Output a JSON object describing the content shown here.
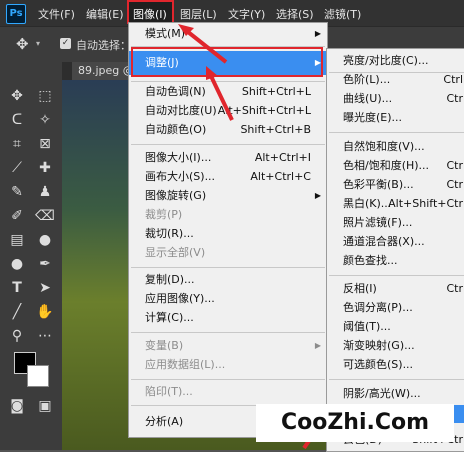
{
  "menubar": {
    "logo": "Ps",
    "items": [
      "文件(F)",
      "编辑(E)",
      "图像(I)",
      "图层(L)",
      "文字(Y)",
      "选择(S)",
      "滤镜(T)"
    ]
  },
  "options": {
    "auto_select_label": "自动选择："
  },
  "document": {
    "tab_label": "89.jpeg @"
  },
  "image_menu": [
    {
      "label": "模式(M)",
      "shortcut": "",
      "submenu": true
    },
    {
      "label": "调整(J)",
      "shortcut": "",
      "submenu": true,
      "highlighted": true
    },
    {
      "label": "自动色调(N)",
      "shortcut": "Shift+Ctrl+L"
    },
    {
      "label": "自动对比度(U)",
      "shortcut": "Alt+Shift+Ctrl+L"
    },
    {
      "label": "自动颜色(O)",
      "shortcut": "Shift+Ctrl+B"
    },
    {
      "label": "图像大小(I)...",
      "shortcut": "Alt+Ctrl+I"
    },
    {
      "label": "画布大小(S)...",
      "shortcut": "Alt+Ctrl+C"
    },
    {
      "label": "图像旋转(G)",
      "shortcut": "",
      "submenu": true
    },
    {
      "label": "裁剪(P)",
      "shortcut": "",
      "disabled": true
    },
    {
      "label": "裁切(R)...",
      "shortcut": ""
    },
    {
      "label": "显示全部(V)",
      "shortcut": "",
      "disabled": true
    },
    {
      "label": "复制(D)...",
      "shortcut": ""
    },
    {
      "label": "应用图像(Y)...",
      "shortcut": ""
    },
    {
      "label": "计算(C)...",
      "shortcut": ""
    },
    {
      "label": "变量(B)",
      "shortcut": "",
      "disabled": true,
      "submenu": true
    },
    {
      "label": "应用数据组(L)...",
      "shortcut": "",
      "disabled": true
    },
    {
      "label": "陷印(T)...",
      "shortcut": "",
      "disabled": true
    },
    {
      "label": "分析(A)",
      "shortcut": "",
      "submenu": true
    }
  ],
  "adjust_menu": [
    {
      "label": "亮度/对比度(C)...",
      "shortcut": ""
    },
    {
      "label": "色阶(L)...",
      "shortcut": "Ctrl"
    },
    {
      "label": "曲线(U)...",
      "shortcut": "Ctr"
    },
    {
      "label": "曝光度(E)...",
      "shortcut": ""
    },
    {
      "label": "自然饱和度(V)...",
      "shortcut": ""
    },
    {
      "label": "色相/饱和度(H)...",
      "shortcut": "Ctr"
    },
    {
      "label": "色彩平衡(B)...",
      "shortcut": "Ctr"
    },
    {
      "label": "黑白(K)...",
      "shortcut": "Alt+Shift+Ctr"
    },
    {
      "label": "照片滤镜(F)...",
      "shortcut": ""
    },
    {
      "label": "通道混合器(X)...",
      "shortcut": ""
    },
    {
      "label": "颜色查找...",
      "shortcut": ""
    },
    {
      "label": "反相(I)",
      "shortcut": "Ctr"
    },
    {
      "label": "色调分离(P)...",
      "shortcut": ""
    },
    {
      "label": "阈值(T)...",
      "shortcut": ""
    },
    {
      "label": "渐变映射(G)...",
      "shortcut": ""
    },
    {
      "label": "可选颜色(S)...",
      "shortcut": ""
    },
    {
      "label": "阴影/高光(W)...",
      "shortcut": ""
    },
    {
      "label": "",
      "shortcut": "",
      "highlighted": true
    },
    {
      "label": "去色(D)",
      "shortcut": "Shift+Ctr"
    }
  ],
  "watermark": "CooZhi.Com",
  "colors": {
    "highlight": "#3a8ef0",
    "annotation": "#e0262d"
  }
}
